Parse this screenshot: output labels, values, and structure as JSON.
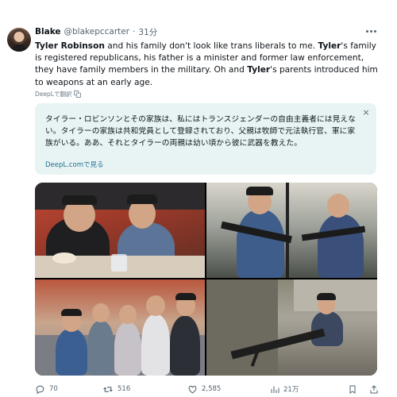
{
  "tweet": {
    "author_name": "Blake",
    "handle": "@blakepccarter",
    "separator": "·",
    "time": "31分",
    "text": {
      "p1_bold": "Tyler Robinson",
      "p1_rest": " and his family don't look like trans liberals to me. ",
      "p2_bold": "Tyler",
      "p2_rest": "'s family is registered republicans, his father is a minister and former law enforcement, they have family members in the military. Oh and ",
      "p3_bold": "Tyler",
      "p3_rest": "'s parents introduced him to weapons at an early age."
    },
    "deepl_label": "DeepLで翻訳",
    "translation": {
      "text": "タイラー・ロビンソンとその家族は、私にはトランスジェンダーの自由主義者には見えない。タイラーの家族は共和党員として登録されており、父親は牧師で元法執行官、軍に家族がいる。ああ、それとタイラーの両親は幼い頃から彼に武器を教えた。",
      "link": "DeepL.comで見る",
      "close_symbol": "×"
    },
    "stats": {
      "replies": "70",
      "reposts": "516",
      "likes": "2,585",
      "views": "21万"
    },
    "icons": {
      "avatar": "user-avatar",
      "more": "more-icon",
      "translate": "translate-icon",
      "reply": "reply-icon",
      "repost": "repost-icon",
      "like": "heart-icon",
      "views": "views-icon",
      "bookmark": "bookmark-icon",
      "share": "share-icon"
    },
    "colors": {
      "text": "#0f1419",
      "muted": "#536471",
      "translation_bg": "#e8f4f4",
      "link": "#1d6f8e"
    }
  }
}
